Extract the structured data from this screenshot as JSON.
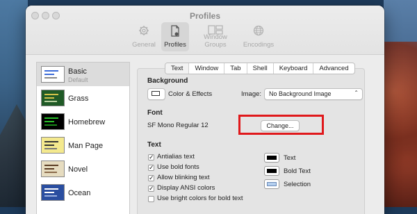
{
  "window": {
    "title": "Profiles"
  },
  "toolbar": [
    {
      "label": "General",
      "icon": "gear-icon"
    },
    {
      "label": "Profiles",
      "icon": "profiles-icon"
    },
    {
      "label": "Window Groups",
      "icon": "window-groups-icon"
    },
    {
      "label": "Encodings",
      "icon": "globe-icon"
    }
  ],
  "profiles": [
    {
      "name": "Basic",
      "subtitle": "Default",
      "thumb_bg": "#ffffff",
      "thumb_fg": "#3a6ad8"
    },
    {
      "name": "Grass",
      "subtitle": "",
      "thumb_bg": "#1f5a26",
      "thumb_fg": "#d2c24a"
    },
    {
      "name": "Homebrew",
      "subtitle": "",
      "thumb_bg": "#000000",
      "thumb_fg": "#29c12a"
    },
    {
      "name": "Man Page",
      "subtitle": "",
      "thumb_bg": "#f4e98e",
      "thumb_fg": "#333333"
    },
    {
      "name": "Novel",
      "subtitle": "",
      "thumb_bg": "#e6dcc0",
      "thumb_fg": "#5a3b22"
    },
    {
      "name": "Ocean",
      "subtitle": "",
      "thumb_bg": "#2a4ea0",
      "thumb_fg": "#ffffff"
    }
  ],
  "tabs": [
    "Text",
    "Window",
    "Tab",
    "Shell",
    "Keyboard",
    "Advanced"
  ],
  "active_tab": "Text",
  "background": {
    "heading": "Background",
    "button": "Color & Effects",
    "image_label": "Image:",
    "image_value": "No Background Image"
  },
  "font": {
    "heading": "Font",
    "value": "SF Mono Regular 12",
    "change_button": "Change..."
  },
  "text": {
    "heading": "Text",
    "options": [
      {
        "label": "Antialias text",
        "checked": true
      },
      {
        "label": "Use bold fonts",
        "checked": true
      },
      {
        "label": "Allow blinking text",
        "checked": true
      },
      {
        "label": "Display ANSI colors",
        "checked": true
      },
      {
        "label": "Use bright colors for bold text",
        "checked": false
      }
    ],
    "colors": [
      {
        "label": "Text",
        "color": "#000000"
      },
      {
        "label": "Bold Text",
        "color": "#000000"
      },
      {
        "label": "Selection",
        "color": "#b4cfee"
      }
    ]
  },
  "highlight_color": "#e0181b"
}
